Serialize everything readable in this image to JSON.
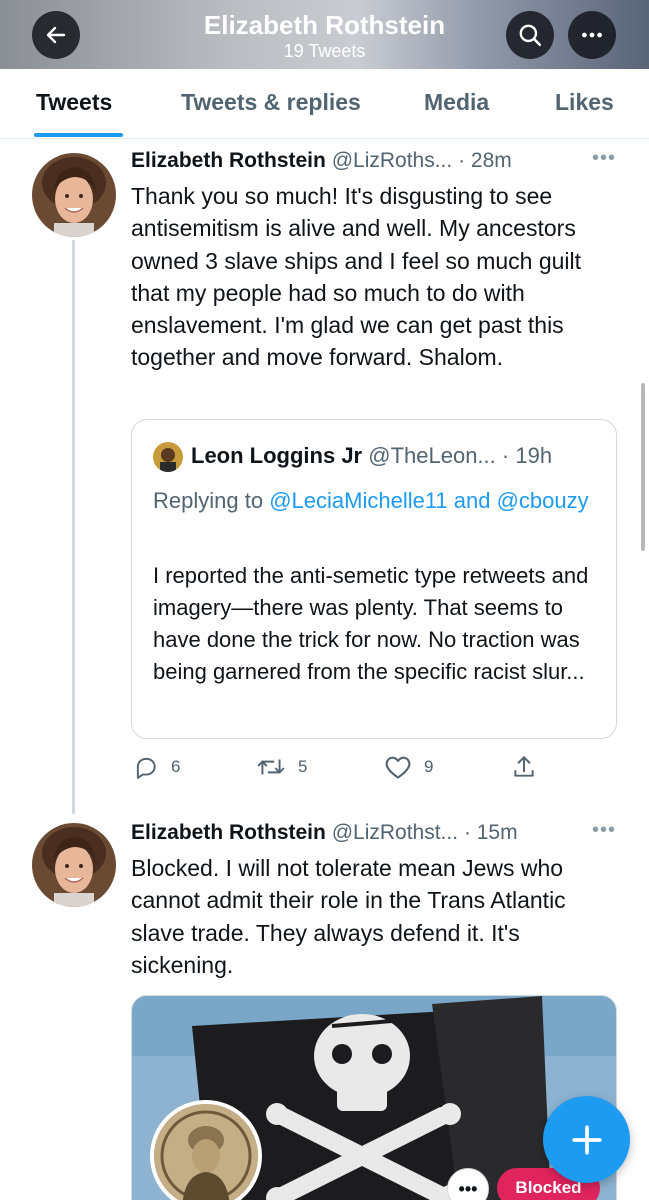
{
  "header": {
    "title": "Elizabeth Rothstein",
    "subtitle": "19 Tweets",
    "back_icon": "arrow-left-icon",
    "search_icon": "search-icon",
    "more_icon": "more-horizontal-icon"
  },
  "tabs": [
    {
      "label": "Tweets",
      "active": true
    },
    {
      "label": "Tweets & replies",
      "active": false
    },
    {
      "label": "Media",
      "active": false
    },
    {
      "label": "Likes",
      "active": false
    }
  ],
  "tweets": [
    {
      "name": "Elizabeth Rothstein",
      "handle": "@LizRoths...",
      "time": "· 28m",
      "text": "Thank you so much! It's disgusting to see antisemitism is alive and well. My ancestors owned 3 slave ships and I feel so much guilt that my people had so much to do with enslavement. I'm glad we can get past this together and move forward. Shalom.",
      "quote": {
        "name": "Leon Loggins Jr",
        "handle": "@TheLeon...",
        "time": "· 19h",
        "reply_prefix": "Replying to",
        "reply_to": "@LeciaMichelle11 and @cbouzy",
        "text": "I reported the anti-semetic type retweets and imagery—there was plenty. That seems to have done the trick for now. No traction was being garnered from the specific racist slur..."
      },
      "actions": {
        "replies": "6",
        "retweets": "5",
        "likes": "9"
      }
    },
    {
      "name": "Elizabeth Rothstein",
      "handle": "@LizRothst...",
      "time": "· 15m",
      "text": "Blocked. I will not tolerate mean Jews who cannot admit their role in the Trans Atlantic slave trade. They always defend it. It's sickening.",
      "card": {
        "more_label": "•••",
        "blocked_label": "Blocked"
      }
    }
  ],
  "colors": {
    "accent": "#1d9bf0",
    "blocked": "#e0245e",
    "secondary_text": "#536471"
  },
  "fab": {
    "icon": "compose-plus-icon"
  }
}
